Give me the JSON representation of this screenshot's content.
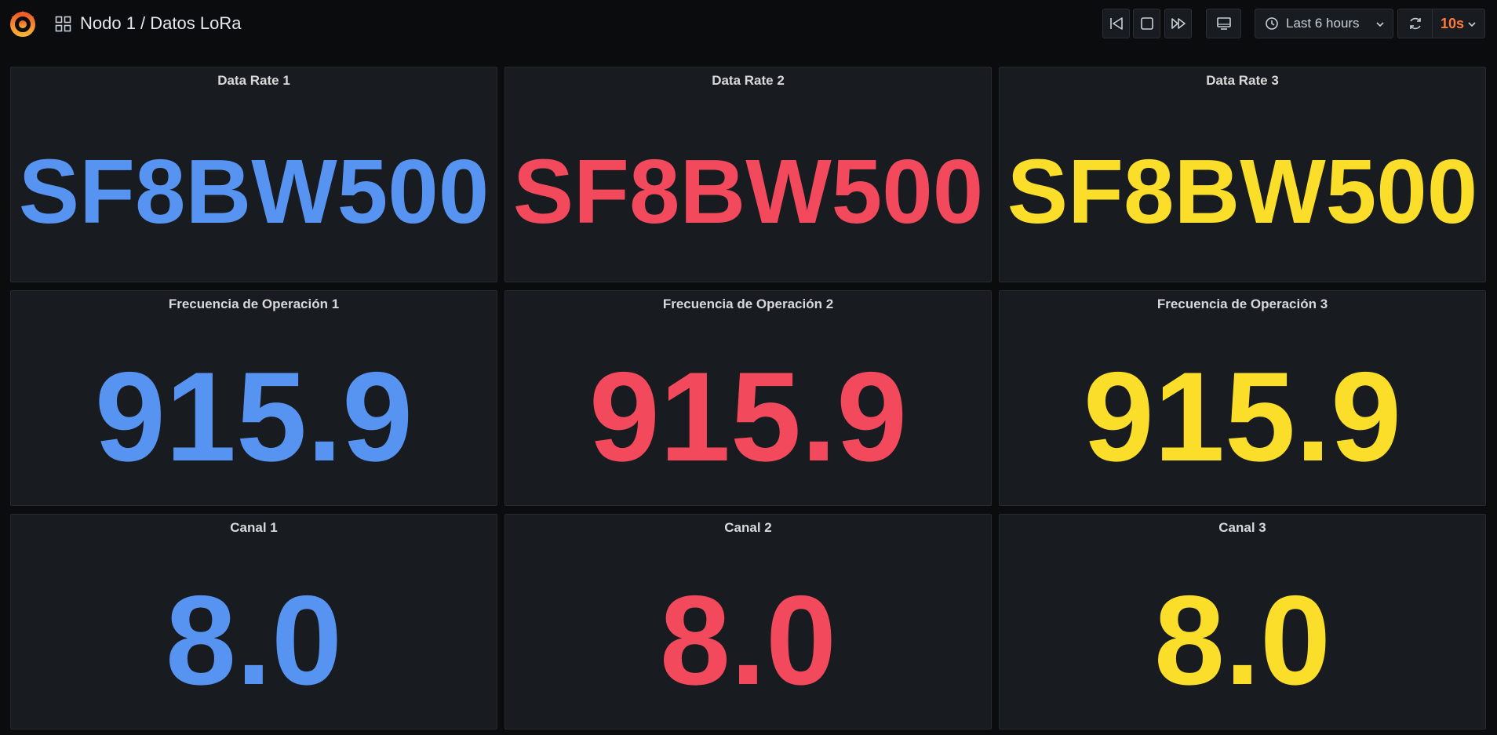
{
  "header": {
    "title": "Nodo 1 / Datos LoRa",
    "time_range": "Last 6 hours",
    "refresh_interval": "10s"
  },
  "colors": {
    "series_1": "#5794f2",
    "series_2": "#f2495c",
    "series_3": "#fade2a",
    "refresh_accent": "#ff7b3d"
  },
  "panels": [
    {
      "title": "Data Rate 1",
      "value": "SF8BW500"
    },
    {
      "title": "Data Rate 2",
      "value": "SF8BW500"
    },
    {
      "title": "Data Rate 3",
      "value": "SF8BW500"
    },
    {
      "title": "Frecuencia de Operación 1",
      "value": "915.9"
    },
    {
      "title": "Frecuencia de Operación 2",
      "value": "915.9"
    },
    {
      "title": "Frecuencia de Operación 3",
      "value": "915.9"
    },
    {
      "title": "Canal 1",
      "value": "8.0"
    },
    {
      "title": "Canal 2",
      "value": "8.0"
    },
    {
      "title": "Canal 3",
      "value": "8.0"
    }
  ]
}
